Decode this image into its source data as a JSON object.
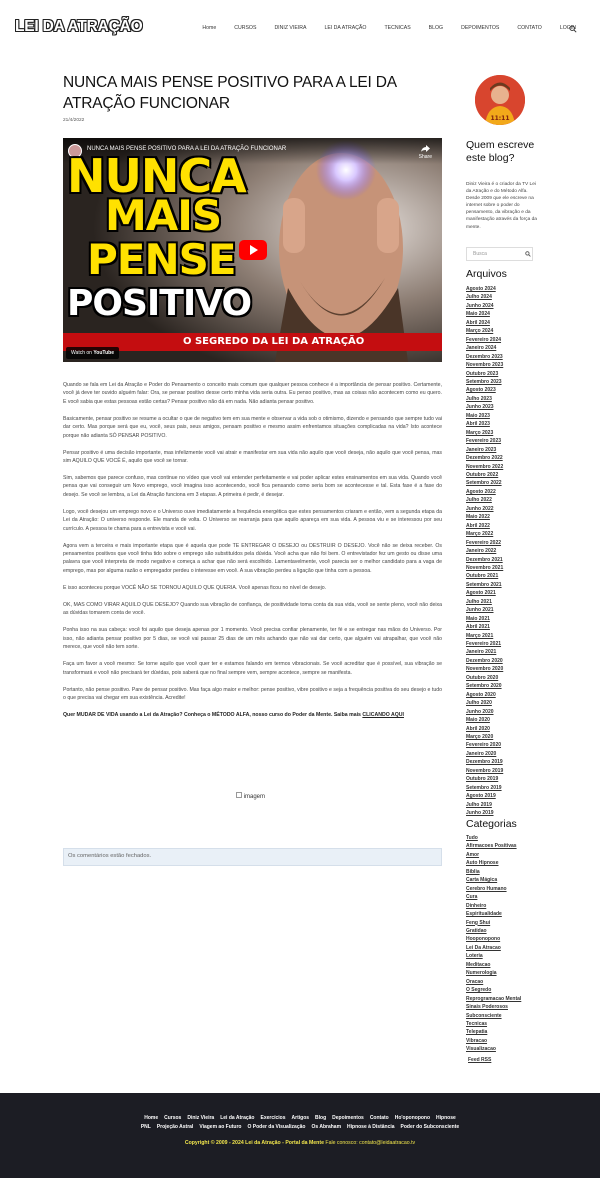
{
  "header": {
    "logo": "LEI DA ATRAÇÃO",
    "nav": [
      "Home",
      "CURSOS",
      "DINIZ VIEIRA",
      "LEI DA ATRAÇÃO",
      "TECNICAS",
      "BLOG",
      "DEPOIMENTOS",
      "CONTATO",
      "LOGIN"
    ]
  },
  "post": {
    "title": "NUNCA MAIS PENSE POSITIVO PARA A LEI DA ATRAÇÃO FUNCIONAR",
    "date": "21/4/2022",
    "video": {
      "title": "NUNCA MAIS PENSE POSITIVO PARA A LEI DA ATRAÇÃO FUNCIONAR",
      "share": "Share",
      "thumb_line1": "NUNCA",
      "thumb_line2": "MAIS",
      "thumb_line3": "PENSE",
      "thumb_line4": "POSITIVO",
      "banner": "O SEGREDO DA LEI DA ATRAÇÃO",
      "watch_on": "Watch on",
      "youtube": "YouTube"
    },
    "paragraphs": [
      "Quando se fala em Lei da Atração e Poder do Pensamento o conceito mais comum que qualquer pessoa conhece é a importância de pensar positivo. Certamente, você já deve ter ouvido alguém falar: Ora, se pensar positivo desse certo minha vida seria outra. Eu penso positivo, mas as coisas não acontecem como eu quero. E você sabia que estas pessoas estão certas? Pensar positivo não dá em nada. Não adianta pensar positivo.",
      "Basicamente, pensar positivo se resume a ocultar o que de negativo tem em sua mente e observar a vida sob o otimismo, dizendo e pensando que sempre tudo vai dar certo. Mas porque será que eu, você, seus pais, seus amigos, pensam positivo e mesmo assim enfrentamos situações complicadas na vida? Isto acontece porque não adianta SÓ PENSAR POSITIVO.",
      "Pensar positivo é uma decisão importante, mas infelizmente você vai atrair e manifestar em sua vida não aquilo que você deseja, não aquilo que você pensa, mas sim AQUILO QUE VOCÊ É, aquilo que você se tornar.",
      "Sim, sabemos que parece confuso, mas continue no vídeo que você vai entender perfeitamente e vai poder aplicar estes ensinamentos em sua vida. Quando você pensa que vai conseguir um Novo emprego, você imagina isso acontecendo, você fica pensando como seria bom se acontecesse e tal. Esta fase é a fase do desejo. Se você se lembra, a Lei da Atração funciona em 3 etapas. A primeira é pedir, é desejar.",
      "Logo, você desejou um emprego novo e o Universo ouve imediatamente a frequência energética que estes pensamentos criaram e então, vem a segunda etapa da Lei da Atração: O universo responde. Ele manda de volta. O Universo se rearranja para que aquilo apareça em sua vida. A pessoa viu e se interessou por seu currículo. A pessoa te chama para a entrevista e você vai.",
      "Agora vem a terceira e mais importante etapa que é aquela que pode TE ENTREGAR O DESEJO ou DESTRUIR O DESEJO. Você não se deixa receber. Os pensamentos positivos que você tinha tido sobre o emprego são substituídos pela dúvida. Você acha que não foi bem. O entrevistador fez um gesto ou disse uma palavra que você interpreta de modo negativo e começa a achar que não será escolhido. Lamentavelmente, você parecia ser o melhor candidato para a vaga de emprego, mas por alguma razão o empregador perdeu o interesse em você. A sua vibração perdeu a ligação que tinha com a pessoa.",
      "E isso aconteceu porque VOCÊ NÃO SE TORNOU AQUILO QUE QUERIA. Você apenas ficou no nível de desejo.",
      "OK, MAS COMO VIRAR AQUILO QUE DESEJO? Quando sua vibração de confiança, de positividade toma conta da sua vida, você se sente pleno, você não deixa as dúvidas tomarem conta de você.",
      "Ponha isso na sua cabeça: você foi aquilo que deseja apenas por 1 momento. Você precisa confiar plenamente, ter fé e se entregar nas mãos do Universo. Por isso, não adianta pensar positivo por 5 dias, se você vai passar 25 dias de um mês achando que não vai dar certo, que alguém vai atrapalhar, que você não merece, que você não tem sorte.",
      "Faça um favor a você mesmo: Se torne aquilo que você quer ter e estamos falando em termos vibracionais. Se você acreditar que é possível, sua vibração se transformará e você não precisará ter dúvidas, pois saberá que no final sempre vem, sempre acontece, sempre se manifesta.",
      "Portanto, não pense positivo. Pare de pensar positivo. Mas faça algo maior e melhor: pense positivo, vibre positivo e seja a frequência positiva do seu desejo e tudo o que precisa vai chegar em sua existência. Acredite!"
    ],
    "cta_text": "Quer MUDAR DE VIDA usando a Lei da Atração? Conheça o MÉTODO ALFA, nosso curso do Poder da Mente. Saiba mais ",
    "cta_link": "CLICANDO AQUI",
    "image_alt": "imagem",
    "comments_closed": "Os comentários estão fechados."
  },
  "sidebar": {
    "author_heading": "Quem escreve este blog?",
    "author_text": "Diniz Vieira é o criador da TV Lei da Atração e do Método Alfa. Desde 2009 que ele escreve na internet sobre o poder do pensamento, da vibração e da manifestação através da força da mente.",
    "search_placeholder": "Busca",
    "archives_heading": "Arquivos",
    "archives": [
      "Agosto 2024",
      "Julho 2024",
      "Junho 2024",
      "Maio 2024",
      "Abril 2024",
      "Março 2024",
      "Fevereiro 2024",
      "Janeiro 2024",
      "Dezembro 2023",
      "Novembro 2023",
      "Outubro 2023",
      "Setembro 2023",
      "Agosto 2023",
      "Julho 2023",
      "Junho 2023",
      "Maio 2023",
      "Abril 2023",
      "Março 2023",
      "Fevereiro 2023",
      "Janeiro 2023",
      "Dezembro 2022",
      "Novembro 2022",
      "Outubro 2022",
      "Setembro 2022",
      "Agosto 2022",
      "Julho 2022",
      "Junho 2022",
      "Maio 2022",
      "Abril 2022",
      "Março 2022",
      "Fevereiro 2022",
      "Janeiro 2022",
      "Dezembro 2021",
      "Novembro 2021",
      "Outubro 2021",
      "Setembro 2021",
      "Agosto 2021",
      "Julho 2021",
      "Junho 2021",
      "Maio 2021",
      "Abril 2021",
      "Março 2021",
      "Fevereiro 2021",
      "Janeiro 2021",
      "Dezembro 2020",
      "Novembro 2020",
      "Outubro 2020",
      "Setembro 2020",
      "Agosto 2020",
      "Julho 2020",
      "Junho 2020",
      "Maio 2020",
      "Abril 2020",
      "Março 2020",
      "Fevereiro 2020",
      "Janeiro 2020",
      "Dezembro 2019",
      "Novembro 2019",
      "Outubro 2019",
      "Setembro 2019",
      "Agosto 2019",
      "Julho 2019",
      "Junho 2019"
    ],
    "categories_heading": "Categorias",
    "categories": [
      "Tudo",
      "Afirmacoes Positivas",
      "Amor",
      "Auto Hipnose",
      "Bíblia",
      "Carta Mágica",
      "Cerebro Humano",
      "Cura",
      "Dinheiro",
      "Espiritualidade",
      "Feng Shui",
      "Gratidao",
      "Hooponopono",
      "Lei Da Atracao",
      "Loteria",
      "Meditacao",
      "Numerologia",
      "Oracao",
      "O Segredo",
      "Reprogramacao Mental",
      "Sinais Poderosos",
      "Subconsciente",
      "Tecnicas",
      "Telepatia",
      "Vibracao",
      "Visualizacao"
    ],
    "feed": "Feed RSS"
  },
  "footer": {
    "row1": [
      "Home",
      "Cursos",
      "Diniz Vieira",
      "Lei da Atração",
      "Exercícios",
      "Artigos",
      "Blog",
      "Depoimentos",
      "Contato",
      "Ho'oponopono",
      "Hipnose"
    ],
    "row2": [
      "PNL",
      "Projeção Astral",
      "Viagem ao Futuro",
      "O Poder da Visualização",
      "Os Abraham",
      "Hipnose à Distância",
      "Poder do Subconsciente"
    ],
    "copyright": "Copyright © 2009 - 2024 Lei da Atração - Portal da Mente",
    "contact": " Fale conosco: contato@leidaatracao.tv"
  }
}
